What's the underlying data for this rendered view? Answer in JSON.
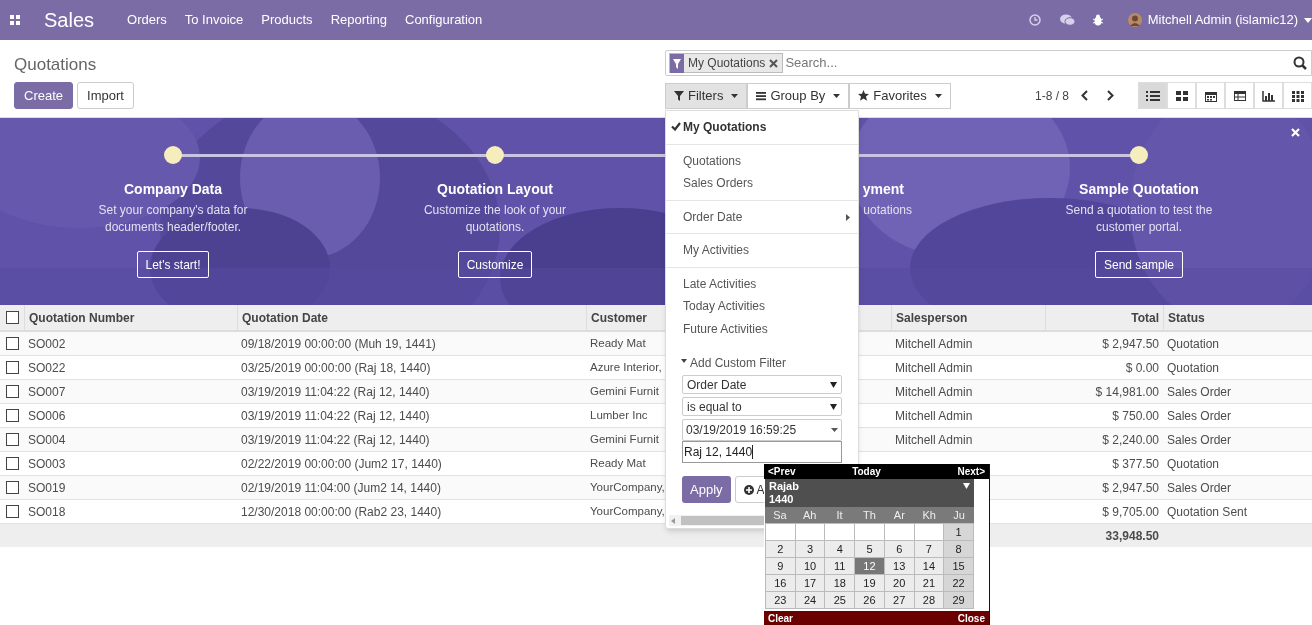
{
  "navbar": {
    "app": "Sales",
    "menu": [
      "Orders",
      "To Invoice",
      "Products",
      "Reporting",
      "Configuration"
    ],
    "user": "Mitchell Admin (islamic12)"
  },
  "breadcrumb": "Quotations",
  "buttons": [
    {
      "label": "Create",
      "kind": "primary"
    },
    {
      "label": "Import",
      "kind": "secondary"
    }
  ],
  "search": {
    "facets": [
      "My Quotations"
    ],
    "placeholder": "Search..."
  },
  "search_options": [
    {
      "label": "Filters",
      "kind": "filter",
      "selected": true
    },
    {
      "label": "Group By",
      "kind": "group",
      "selected": false
    },
    {
      "label": "Favorites",
      "kind": "favorite",
      "selected": false
    }
  ],
  "pager": "1-8 / 8",
  "views": [
    {
      "kind": "list",
      "selected": true
    },
    {
      "kind": "kanban",
      "selected": false
    },
    {
      "kind": "calendar",
      "selected": false
    },
    {
      "kind": "pivot",
      "selected": false
    },
    {
      "kind": "graph",
      "selected": false
    },
    {
      "kind": "activity",
      "selected": false
    }
  ],
  "banner": {
    "steps": [
      {
        "kind": "step",
        "title": "Company Data",
        "description": "Set your company's data for documents header/footer.",
        "button": "Let's start!"
      },
      {
        "kind": "step",
        "title": "Quotation Layout",
        "description": "Customize the look of your quotations.",
        "button": "Customize"
      },
      {
        "kind": "clipped",
        "title": "yment",
        "description": "uotations"
      },
      {
        "kind": "step",
        "title": "Sample Quotation",
        "description": "Send a quotation to test the customer portal.",
        "button": "Send sample"
      }
    ]
  },
  "table": {
    "all_checked": false,
    "columns": [
      "Quotation Number",
      "Quotation Date",
      "Customer",
      "Salesperson",
      "Total",
      "Status"
    ],
    "rows": [
      {
        "checked": false,
        "number": "SO002",
        "date": "09/18/2019 00:00:00 (Muh 19, 1441)",
        "customer": "Ready Mat",
        "salesperson": "Mitchell Admin",
        "total": "$ 2,947.50",
        "status": "Quotation"
      },
      {
        "checked": false,
        "number": "SO022",
        "date": "03/25/2019 00:00:00 (Raj 18, 1440)",
        "customer": "Azure Interior,",
        "salesperson": "Mitchell Admin",
        "total": "$ 0.00",
        "status": "Quotation"
      },
      {
        "checked": false,
        "number": "SO007",
        "date": "03/19/2019 11:04:22 (Raj 12, 1440)",
        "customer": "Gemini Furnit",
        "salesperson": "Mitchell Admin",
        "total": "$ 14,981.00",
        "status": "Sales Order"
      },
      {
        "checked": false,
        "number": "SO006",
        "date": "03/19/2019 11:04:22 (Raj 12, 1440)",
        "customer": "Lumber Inc",
        "salesperson": "Mitchell Admin",
        "total": "$ 750.00",
        "status": "Sales Order"
      },
      {
        "checked": false,
        "number": "SO004",
        "date": "03/19/2019 11:04:22 (Raj 12, 1440)",
        "customer": "Gemini Furnit",
        "salesperson": "Mitchell Admin",
        "total": "$ 2,240.00",
        "status": "Sales Order"
      },
      {
        "checked": false,
        "number": "SO003",
        "date": "02/22/2019 00:00:00 (Jum2 17, 1440)",
        "customer": "Ready Mat",
        "total": "$ 377.50",
        "status": "Quotation"
      },
      {
        "checked": false,
        "number": "SO019",
        "date": "02/19/2019 11:04:00 (Jum2 14, 1440)",
        "customer": "YourCompany,",
        "total": "$ 2,947.50",
        "status": "Sales Order"
      },
      {
        "checked": false,
        "number": "SO018",
        "date": "12/30/2018 00:00:00 (Rab2 23, 1440)",
        "customer": "YourCompany,",
        "total": "$ 9,705.00",
        "status": "Quotation Sent"
      }
    ],
    "footer_total": "33,948.50"
  },
  "filters_menu": {
    "groups": [
      [
        {
          "label": "My Quotations",
          "checked": true
        }
      ],
      [
        {
          "label": "Quotations",
          "checked": false
        },
        {
          "label": "Sales Orders",
          "checked": false
        }
      ],
      [
        {
          "label": "Order Date",
          "checked": false,
          "submenu": true
        }
      ],
      [
        {
          "label": "My Activities",
          "checked": false
        }
      ],
      [
        {
          "label": "Late Activities",
          "checked": false
        },
        {
          "label": "Today Activities",
          "checked": false
        },
        {
          "label": "Future Activities",
          "checked": false
        }
      ]
    ],
    "custom_filter": {
      "label": "Add Custom Filter",
      "expanded": true,
      "field": "Order Date",
      "operator": "is equal to",
      "value": "03/19/2019 16:59:25",
      "input": "Raj 12, 1440",
      "apply": "Apply",
      "add": "A"
    }
  },
  "datepicker": {
    "prev": "<Prev",
    "today": "Today",
    "next": "Next>",
    "month": "Rajab",
    "year": "1440",
    "weekdays": [
      "Sa",
      "Ah",
      "It",
      "Th",
      "Ar",
      "Kh",
      "Ju"
    ],
    "weeks": [
      [
        {
          "kind": "blank"
        },
        {
          "kind": "blank"
        },
        {
          "kind": "blank"
        },
        {
          "kind": "blank"
        },
        {
          "kind": "blank"
        },
        {
          "kind": "blank"
        },
        {
          "kind": "day",
          "label": "1",
          "selected": false
        }
      ],
      [
        {
          "kind": "day",
          "label": "2",
          "selected": false
        },
        {
          "kind": "day",
          "label": "3",
          "selected": false
        },
        {
          "kind": "day",
          "label": "4",
          "selected": false
        },
        {
          "kind": "day",
          "label": "5",
          "selected": false
        },
        {
          "kind": "day",
          "label": "6",
          "selected": false
        },
        {
          "kind": "day",
          "label": "7",
          "selected": false
        },
        {
          "kind": "day",
          "label": "8",
          "selected": false
        }
      ],
      [
        {
          "kind": "day",
          "label": "9",
          "selected": false
        },
        {
          "kind": "day",
          "label": "10",
          "selected": false
        },
        {
          "kind": "day",
          "label": "11",
          "selected": false
        },
        {
          "kind": "day",
          "label": "12",
          "selected": true
        },
        {
          "kind": "day",
          "label": "13",
          "selected": false
        },
        {
          "kind": "day",
          "label": "14",
          "selected": false
        },
        {
          "kind": "day",
          "label": "15",
          "selected": false
        }
      ],
      [
        {
          "kind": "day",
          "label": "16",
          "selected": false
        },
        {
          "kind": "day",
          "label": "17",
          "selected": false
        },
        {
          "kind": "day",
          "label": "18",
          "selected": false
        },
        {
          "kind": "day",
          "label": "19",
          "selected": false
        },
        {
          "kind": "day",
          "label": "20",
          "selected": false
        },
        {
          "kind": "day",
          "label": "21",
          "selected": false
        },
        {
          "kind": "day",
          "label": "22",
          "selected": false
        }
      ],
      [
        {
          "kind": "day",
          "label": "23",
          "selected": false
        },
        {
          "kind": "day",
          "label": "24",
          "selected": false
        },
        {
          "kind": "day",
          "label": "25",
          "selected": false
        },
        {
          "kind": "day",
          "label": "26",
          "selected": false
        },
        {
          "kind": "day",
          "label": "27",
          "selected": false
        },
        {
          "kind": "day",
          "label": "28",
          "selected": false
        },
        {
          "kind": "day",
          "label": "29",
          "selected": false
        }
      ]
    ],
    "clear": "Clear",
    "close": "Close"
  }
}
